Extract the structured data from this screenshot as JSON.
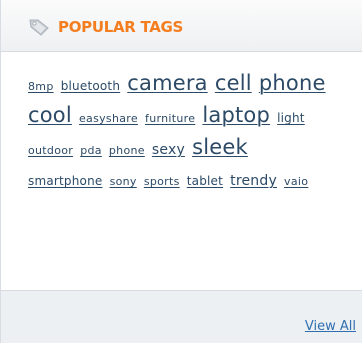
{
  "widget": {
    "title": "POPULAR TAGS",
    "title_icon": "tag-icon",
    "accent_color": "#f47e1f",
    "link_color": "#2c4a66",
    "footer_link_color": "#2f6fb0"
  },
  "tags": [
    {
      "label": "8mp",
      "weight": 1
    },
    {
      "label": "bluetooth",
      "weight": 2
    },
    {
      "label": "camera",
      "weight": 5
    },
    {
      "label": "cell",
      "weight": 5
    },
    {
      "label": "phone",
      "weight": 5
    },
    {
      "label": "cool",
      "weight": 5
    },
    {
      "label": "easyshare",
      "weight": 1
    },
    {
      "label": "furniture",
      "weight": 1
    },
    {
      "label": "laptop",
      "weight": 5
    },
    {
      "label": "light",
      "weight": 2
    },
    {
      "label": "outdoor",
      "weight": 1
    },
    {
      "label": "pda",
      "weight": 1
    },
    {
      "label": "phone",
      "weight": 1
    },
    {
      "label": "sexy",
      "weight": 3
    },
    {
      "label": "sleek",
      "weight": 5
    },
    {
      "label": "smartphone",
      "weight": 2
    },
    {
      "label": "sony",
      "weight": 1
    },
    {
      "label": "sports",
      "weight": 1
    },
    {
      "label": "tablet",
      "weight": 2
    },
    {
      "label": "trendy",
      "weight": 3
    },
    {
      "label": "vaio",
      "weight": 1
    }
  ],
  "footer": {
    "view_all_label": "View All"
  }
}
